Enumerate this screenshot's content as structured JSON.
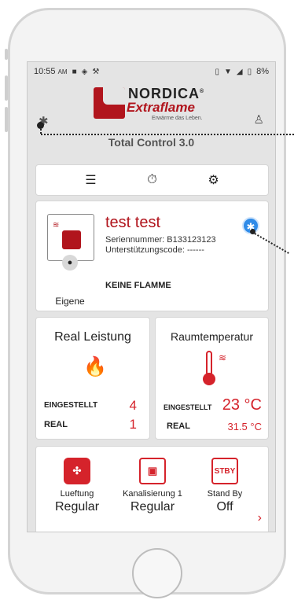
{
  "status_bar": {
    "time": "10:55",
    "ampm": "AM",
    "battery": "8%"
  },
  "header": {
    "logo_nordica": "NORDICA",
    "logo_extraflame": "Extraflame",
    "logo_tagline": "Erwärme das Leben.",
    "app_title": "Total Control 3.0"
  },
  "tabs": [
    {
      "icon": "list-icon"
    },
    {
      "icon": "timer-icon"
    },
    {
      "icon": "gear-icon"
    }
  ],
  "device": {
    "name": "test test",
    "serial": "Seriennummer: B133123123",
    "support_code": "Unterstützungscode: ------",
    "status": "KEINE FLAMME",
    "owner": "Eigene"
  },
  "power": {
    "title": "Real Leistung",
    "set_label": "EINGESTELLT",
    "set_value": "4",
    "real_label": "REAL",
    "real_value": "1"
  },
  "temperature": {
    "title": "Raumtemperatur",
    "set_label": "EINGESTELLT",
    "set_value": "23 °C",
    "real_label": "REAL",
    "real_value": "31.5 °C"
  },
  "modes": [
    {
      "label": "Lueftung",
      "value": "Regular",
      "icon": "fan-icon"
    },
    {
      "label": "Kanalisierung 1",
      "value": "Regular",
      "icon": "duct-icon"
    },
    {
      "label": "Stand By",
      "value": "Off",
      "icon": "stby-icon",
      "icon_text": "STBY"
    }
  ],
  "colors": {
    "accent": "#d5232b",
    "brand_red": "#b1151d",
    "bluetooth": "#2f8be8"
  }
}
